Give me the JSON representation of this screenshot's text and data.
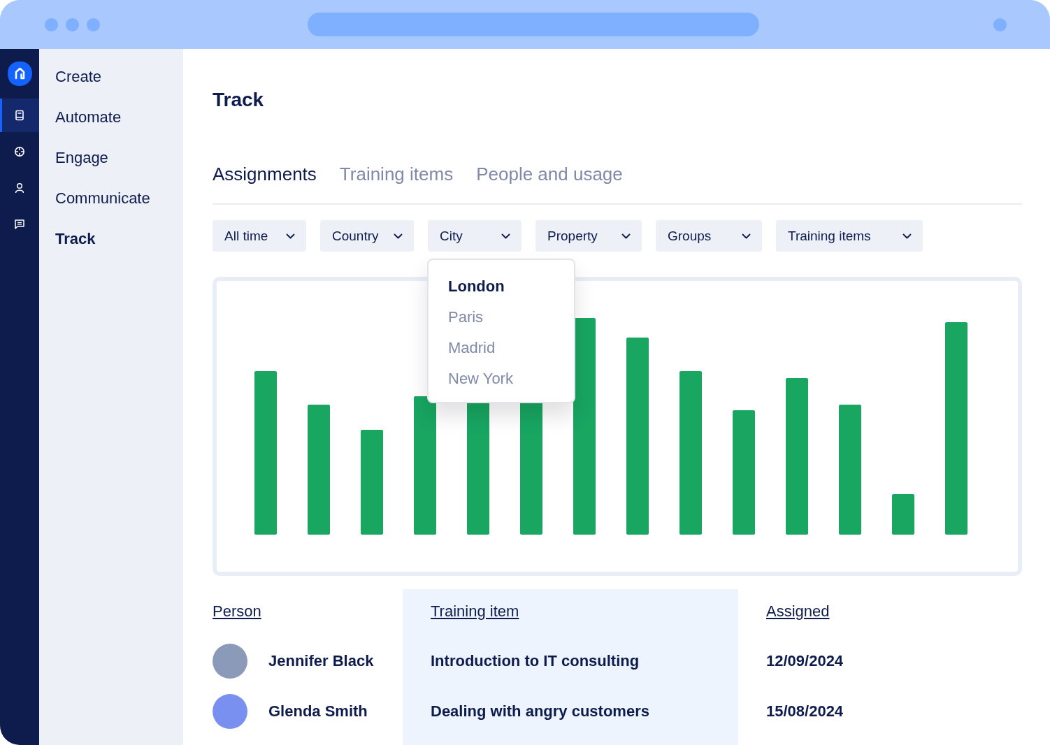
{
  "rail": {
    "items": [
      {
        "kind": "book",
        "selected": true
      },
      {
        "kind": "target",
        "selected": false
      },
      {
        "kind": "person",
        "selected": false
      },
      {
        "kind": "chat",
        "selected": false
      }
    ]
  },
  "nav": {
    "items": [
      {
        "label": "Create",
        "selected": false
      },
      {
        "label": "Automate",
        "selected": false
      },
      {
        "label": "Engage",
        "selected": false
      },
      {
        "label": "Communicate",
        "selected": false
      },
      {
        "label": "Track",
        "selected": true
      }
    ]
  },
  "page": {
    "title": "Track"
  },
  "tabs": [
    {
      "label": "Assignments",
      "selected": true
    },
    {
      "label": "Training items",
      "selected": false
    },
    {
      "label": "People and usage",
      "selected": false
    }
  ],
  "filters": [
    {
      "label": "All time"
    },
    {
      "label": "Country"
    },
    {
      "label": "City",
      "options": [
        {
          "label": "London",
          "selected": true
        },
        {
          "label": "Paris",
          "selected": false
        },
        {
          "label": "Madrid",
          "selected": false
        },
        {
          "label": "New York",
          "selected": false
        }
      ]
    },
    {
      "label": "Property"
    },
    {
      "label": "Groups"
    },
    {
      "label": "Training items"
    }
  ],
  "table": {
    "columns": [
      {
        "label": "Person",
        "highlighted": false
      },
      {
        "label": "Training item",
        "highlighted": true
      },
      {
        "label": "Assigned",
        "highlighted": false
      }
    ],
    "rows": [
      {
        "person": "Jennifer Black",
        "training_item": "Introduction to IT consulting",
        "assigned": "12/09/2024"
      },
      {
        "person": "Glenda Smith",
        "training_item": "Dealing with angry customers",
        "assigned": "15/08/2024"
      }
    ]
  }
}
